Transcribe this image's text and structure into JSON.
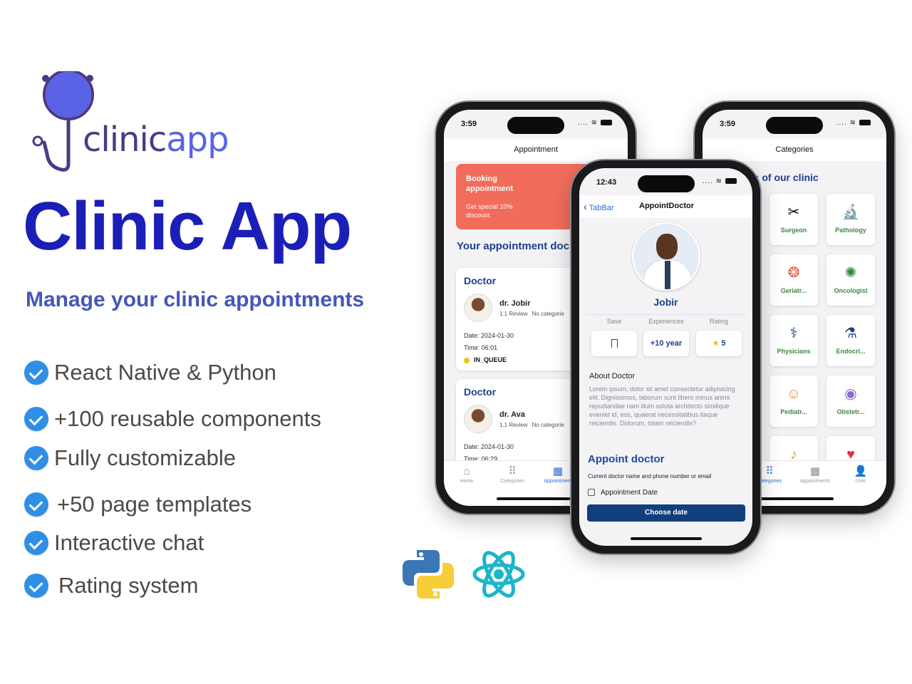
{
  "logo": {
    "word1": "clinic",
    "word2": "app",
    "colors": {
      "ring": "#5a63e6",
      "tube": "#4b3a86",
      "text1": "#4b3a86",
      "text2": "#5a63e6"
    }
  },
  "hero": {
    "title": "Clinic App",
    "subtitle": "Manage your clinic appointments",
    "title_color": "#1b1fb8",
    "subtitle_color": "#4457b8"
  },
  "features": [
    {
      "text": "React  Native & Python",
      "icon": "check-circle-icon"
    },
    {
      "text": "+100 reusable components",
      "icon": "check-circle-icon"
    },
    {
      "text": "Fully customizable",
      "icon": "check-circle-icon"
    },
    {
      "text": "+50 page templates",
      "icon": "check-circle-icon"
    },
    {
      "text": "Interactive chat",
      "icon": "check-circle-icon"
    },
    {
      "text": " Rating system",
      "icon": "check-circle-icon"
    }
  ],
  "phone1": {
    "time": "3:59",
    "status": "....",
    "title": "Appointment",
    "banner": {
      "title": "Booking appointment",
      "sub": "Get special 10% discount",
      "color": "#f26c5b"
    },
    "section_title": "Your appointment doc",
    "cards": [
      {
        "heading": "Doctor",
        "name": "dr. Jobir",
        "reviews": "1.1 Review",
        "category": "No categorie",
        "date": "Date: 2024-01-30",
        "time": "Time: 06:01",
        "status": "IN_QUEUE"
      },
      {
        "heading": "Doctor",
        "name": "dr. Ava",
        "reviews": "1.1 Review",
        "category": "No categorie",
        "date": "Date: 2024-01-30",
        "time": "Time: 06:29"
      }
    ],
    "tabs": [
      {
        "label": "Home",
        "icon": "home-icon",
        "glyph": "⌂"
      },
      {
        "label": "Categories",
        "icon": "grid-icon",
        "glyph": "⠿"
      },
      {
        "label": "Appointment",
        "icon": "calendar-icon",
        "glyph": "▦"
      }
    ]
  },
  "phone2": {
    "time": "12:43",
    "status": "....",
    "back_label": "TabBar",
    "title": "AppointDoctor",
    "doctor_name": "Jobir",
    "stats": [
      {
        "header": "Save",
        "value": ""
      },
      {
        "header": "Experiences",
        "value": "+10 year"
      },
      {
        "header": "Rating",
        "value": "5",
        "glyph": "★"
      }
    ],
    "about_heading": "About Doctor",
    "about_text": "Lorem ipsum, dolor sit amet consectetur adipisicing elit. Dignissimos, laborum sunt libero minus animi repudiandae nam illum soluta architecto similique eveniet id, eos, quaerat necessitatibus itaque reiciendis. Dolorum, totam reiciendis?",
    "appoint_heading": "Appoint doctor",
    "appoint_sub": "Current doctor name and phone number or email",
    "appoint_date_label": "Appointment Date",
    "choose_button": "Choose date",
    "button_color": "#123e7c"
  },
  "phone3": {
    "time": "3:59",
    "status": "....",
    "title": "Categories",
    "section_title": "ies of our clinic",
    "categories": [
      {
        "label": "Surgeon",
        "icon": "surgeon-icon",
        "glyph": "✂"
      },
      {
        "label": "Pathology",
        "icon": "microscope-icon",
        "glyph": "🔬"
      },
      {
        "label": "Geriatr...",
        "icon": "geriatrics-icon",
        "glyph": "❂"
      },
      {
        "label": "Oncologist",
        "icon": "oncology-icon",
        "glyph": "✺"
      },
      {
        "label": "Physicians",
        "icon": "physician-icon",
        "glyph": "⚕"
      },
      {
        "label": "Endocri...",
        "icon": "endocrine-icon",
        "glyph": "⚗"
      },
      {
        "label": "Pediatr...",
        "icon": "pediatrics-icon",
        "glyph": "☺"
      },
      {
        "label": "Obstetr...",
        "icon": "obstetrics-icon",
        "glyph": "◉"
      },
      {
        "label": "",
        "icon": "digestive-icon",
        "glyph": "♪"
      },
      {
        "label": "",
        "icon": "heart-icon",
        "glyph": "♥"
      }
    ],
    "tabs": [
      {
        "label": "Categories",
        "icon": "grid-icon",
        "glyph": "⠿"
      },
      {
        "label": "Appointments",
        "icon": "calendar-icon",
        "glyph": "▦"
      },
      {
        "label": "User",
        "icon": "user-icon",
        "glyph": "👤"
      }
    ]
  },
  "tech": [
    {
      "name": "python-logo",
      "colors": [
        "#3b77b5",
        "#f7cd3a"
      ]
    },
    {
      "name": "react-logo",
      "colors": [
        "#1ab6c9"
      ]
    }
  ]
}
